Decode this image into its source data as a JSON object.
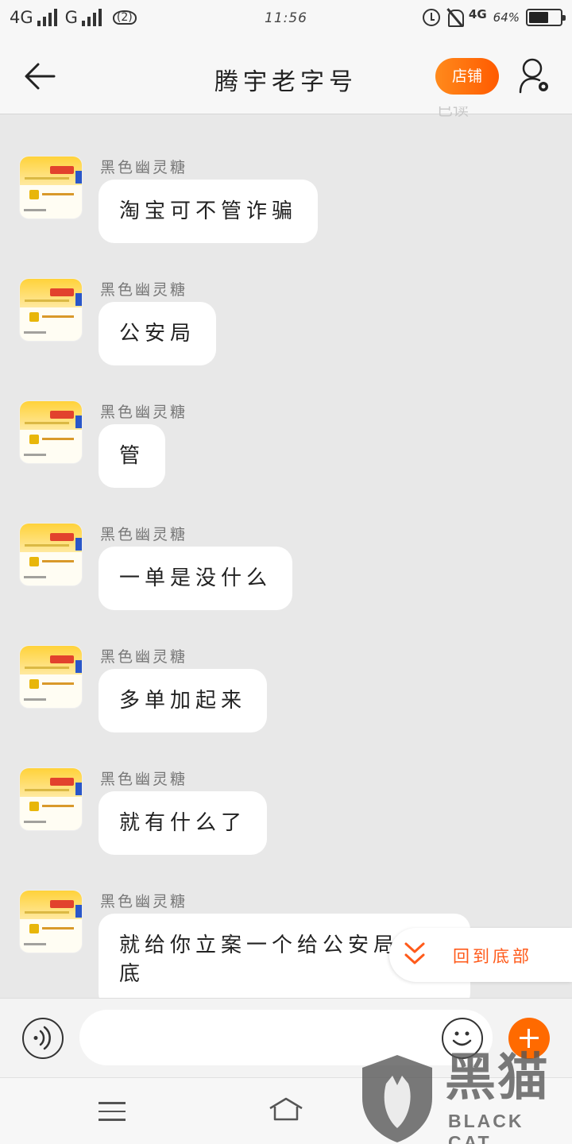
{
  "status_bar": {
    "carrier1": "4G",
    "carrier2": "G",
    "wifi_badge": "(2)",
    "time": "11:56",
    "network": "4G",
    "battery": "64%",
    "battery_level": 0.64
  },
  "header": {
    "title": "腾宇老字号",
    "shop_button": "店铺",
    "peek_text": "已读"
  },
  "messages": [
    {
      "sender": "黑色幽灵糖",
      "text": "淘宝可不管诈骗"
    },
    {
      "sender": "黑色幽灵糖",
      "text": "公安局"
    },
    {
      "sender": "黑色幽灵糖",
      "text": "管"
    },
    {
      "sender": "黑色幽灵糖",
      "text": "一单是没什么"
    },
    {
      "sender": "黑色幽灵糖",
      "text": "多单加起来"
    },
    {
      "sender": "黑色幽灵糖",
      "text": "就有什么了"
    },
    {
      "sender": "黑色幽灵糖",
      "text": "就给你立案一个给公安局留个底"
    }
  ],
  "back_to_bottom": {
    "label": "回到底部"
  },
  "input": {
    "placeholder": ""
  },
  "watermark": {
    "text": "黑猫",
    "sub": "BLACK CAT"
  },
  "colors": {
    "accent": "#ff6a00",
    "background": "#e8e8e8",
    "bubble": "#ffffff"
  }
}
